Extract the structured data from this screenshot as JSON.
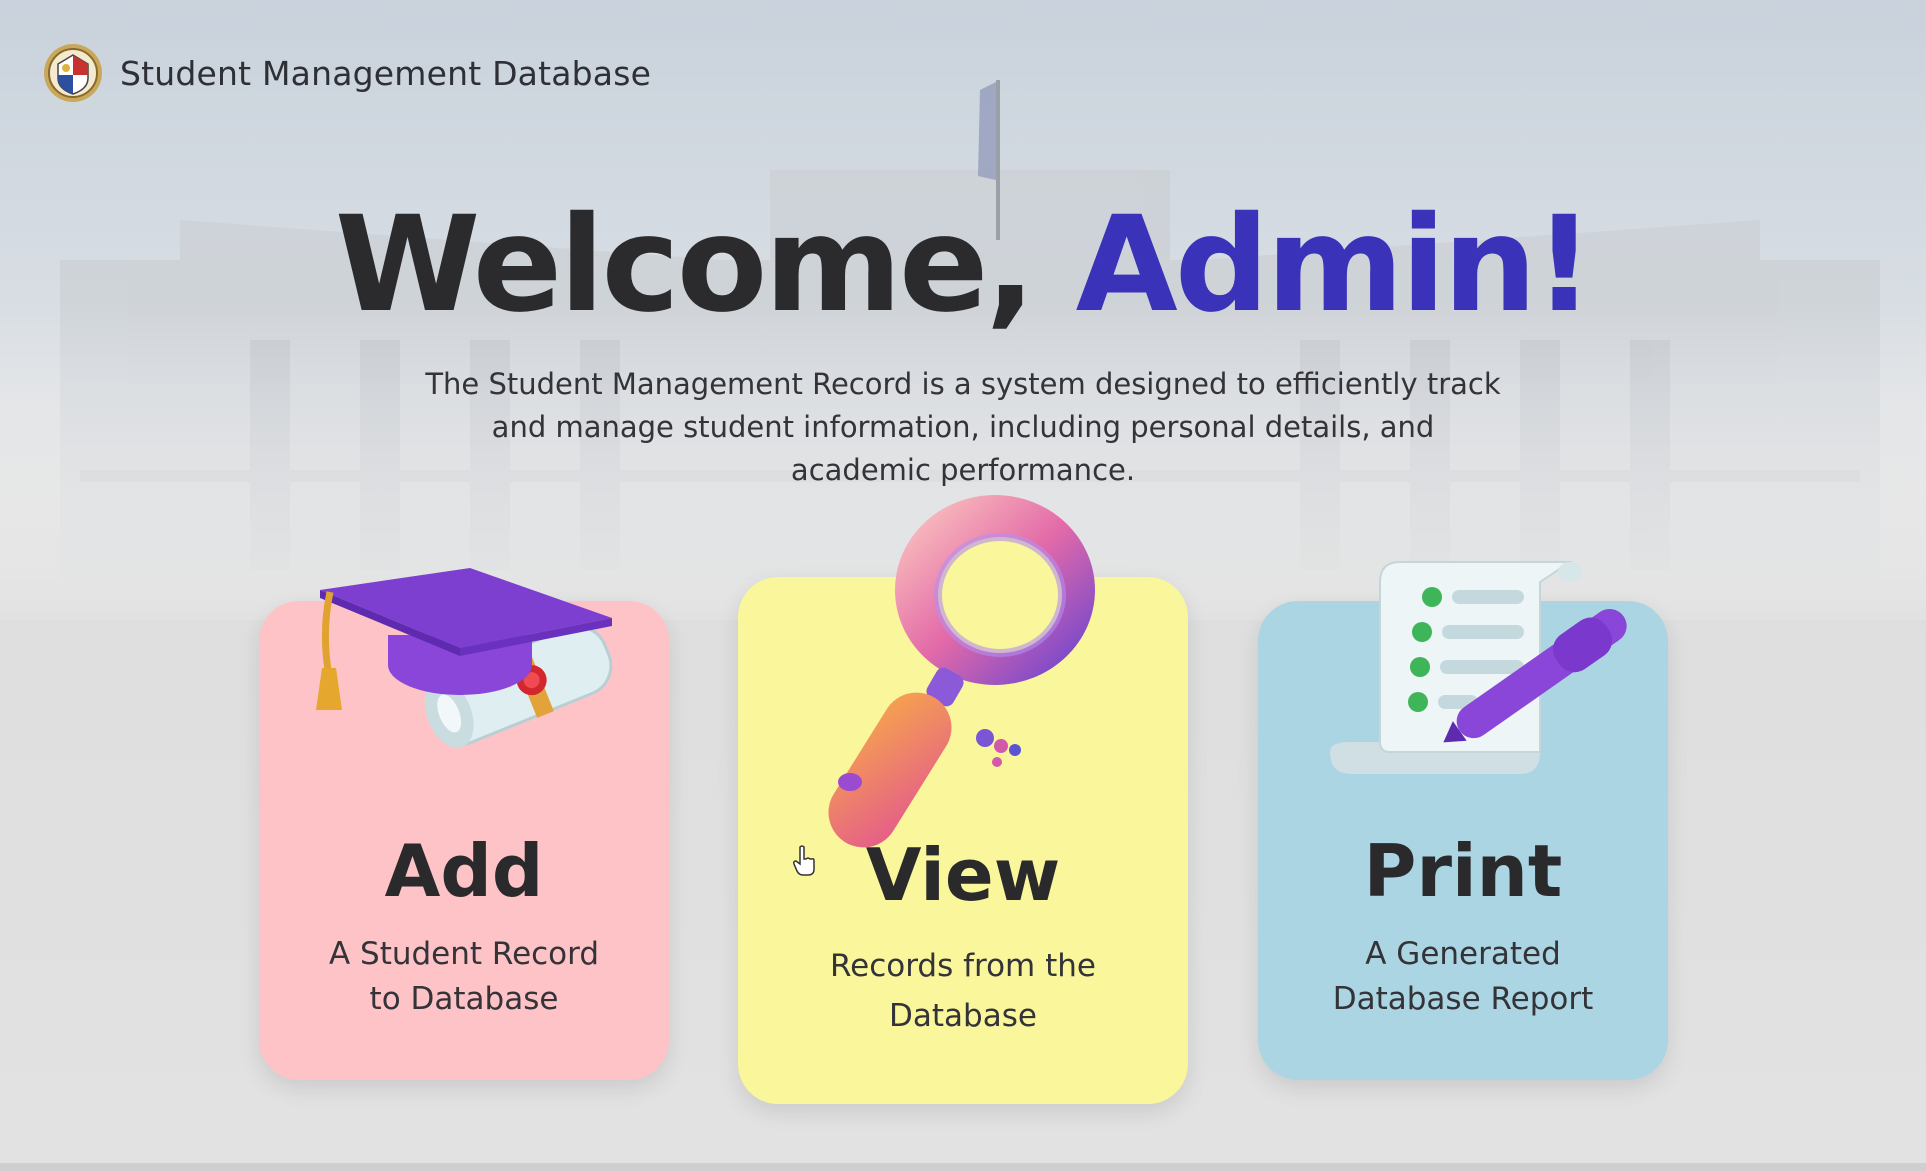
{
  "header": {
    "app_title": "Student Management Database",
    "logo_icon": "university-seal-icon"
  },
  "hero": {
    "welcome_prefix": "Welcome, ",
    "welcome_name": "Admin!",
    "description_line1": "The Student Management Record is a system designed to efficiently track",
    "description_line2": "and manage student information, including personal details, and",
    "description_line3": "academic performance."
  },
  "cards": {
    "add": {
      "title": "Add",
      "desc_line1": "A Student Record",
      "desc_line2": "to Database",
      "icon": "graduation-cap-diploma-icon",
      "color": "#fec3c6"
    },
    "view": {
      "title": "View",
      "desc_line1": "Records from the",
      "desc_line2": "Database",
      "icon": "magnifying-glass-icon",
      "color": "#f9f69c"
    },
    "print": {
      "title": "Print",
      "desc_line1": "A Generated",
      "desc_line2": "Database Report",
      "icon": "report-document-pen-icon",
      "color": "#acd5e4"
    }
  },
  "colors": {
    "accent": "#3a32b8",
    "text_dark": "#2b2b2d"
  }
}
